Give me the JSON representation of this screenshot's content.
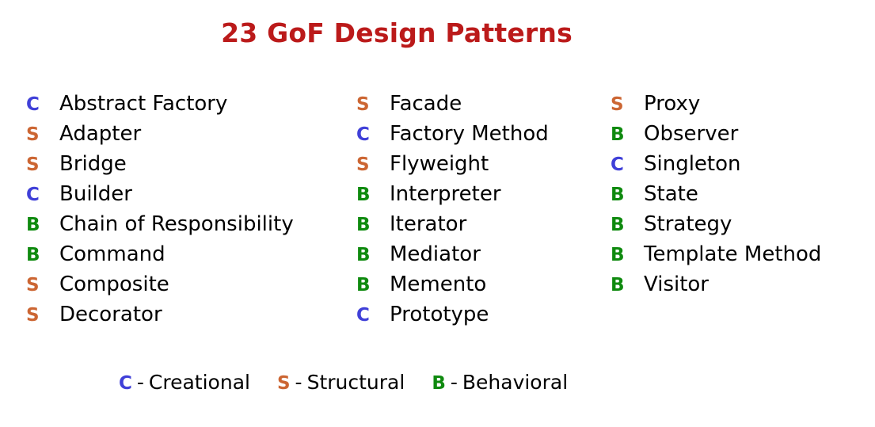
{
  "title": "23 GoF Design Patterns",
  "colors": {
    "title": "#bb1a1a",
    "creational": "#4040d8",
    "structural": "#cc6633",
    "behavioral": "#0f8a0f",
    "text": "#000000",
    "background": "#ffffff"
  },
  "columns": [
    {
      "items": [
        {
          "category": "C",
          "name": "Abstract Factory"
        },
        {
          "category": "S",
          "name": "Adapter"
        },
        {
          "category": "S",
          "name": "Bridge"
        },
        {
          "category": "C",
          "name": "Builder"
        },
        {
          "category": "B",
          "name": "Chain of Responsibility"
        },
        {
          "category": "B",
          "name": "Command"
        },
        {
          "category": "S",
          "name": "Composite"
        },
        {
          "category": "S",
          "name": "Decorator"
        }
      ]
    },
    {
      "items": [
        {
          "category": "S",
          "name": "Facade"
        },
        {
          "category": "C",
          "name": "Factory Method"
        },
        {
          "category": "S",
          "name": "Flyweight"
        },
        {
          "category": "B",
          "name": "Interpreter"
        },
        {
          "category": "B",
          "name": "Iterator"
        },
        {
          "category": "B",
          "name": "Mediator"
        },
        {
          "category": "B",
          "name": "Memento"
        },
        {
          "category": "C",
          "name": "Prototype"
        }
      ]
    },
    {
      "items": [
        {
          "category": "S",
          "name": "Proxy"
        },
        {
          "category": "B",
          "name": "Observer"
        },
        {
          "category": "C",
          "name": "Singleton"
        },
        {
          "category": "B",
          "name": "State"
        },
        {
          "category": "B",
          "name": "Strategy"
        },
        {
          "category": "B",
          "name": "Template Method"
        },
        {
          "category": "B",
          "name": "Visitor"
        }
      ]
    }
  ],
  "legend": [
    {
      "letter": "C",
      "dash": "-",
      "label": "Creational"
    },
    {
      "letter": "S",
      "dash": "-",
      "label": "Structural"
    },
    {
      "letter": "B",
      "dash": "-",
      "label": "Behavioral"
    }
  ]
}
